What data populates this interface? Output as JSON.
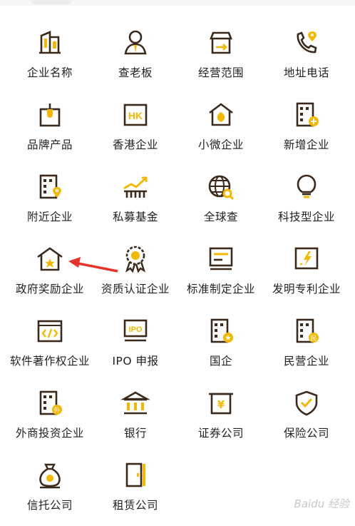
{
  "items": [
    {
      "label": "企业名称",
      "icon": "building-icon"
    },
    {
      "label": "查老板",
      "icon": "person-icon"
    },
    {
      "label": "经营范围",
      "icon": "shop-icon"
    },
    {
      "label": "地址电话",
      "icon": "phone-location-icon"
    },
    {
      "label": "品牌产品",
      "icon": "brand-product-icon"
    },
    {
      "label": "香港企业",
      "icon": "hk-badge-icon"
    },
    {
      "label": "小微企业",
      "icon": "house-leaf-icon"
    },
    {
      "label": "新增企业",
      "icon": "building-plus-icon"
    },
    {
      "label": "附近企业",
      "icon": "building-pin-icon"
    },
    {
      "label": "私募基金",
      "icon": "rising-chart-icon"
    },
    {
      "label": "全球查",
      "icon": "globe-search-icon"
    },
    {
      "label": "科技型企业",
      "icon": "lightbulb-icon"
    },
    {
      "label": "政府奖励企业",
      "icon": "house-star-icon"
    },
    {
      "label": "资质认证企业",
      "icon": "award-rosette-icon"
    },
    {
      "label": "标准制定企业",
      "icon": "document-lines-icon"
    },
    {
      "label": "发明专利企业",
      "icon": "patent-icon"
    },
    {
      "label": "软件著作权企业",
      "icon": "code-window-icon"
    },
    {
      "label": "IPO 申报",
      "icon": "ipo-icon"
    },
    {
      "label": "国企",
      "icon": "building-star-icon"
    },
    {
      "label": "民营企业",
      "icon": "building-private-icon"
    },
    {
      "label": "外商投资企业",
      "icon": "building-foreign-icon"
    },
    {
      "label": "银行",
      "icon": "bank-icon"
    },
    {
      "label": "证券公司",
      "icon": "yen-board-icon"
    },
    {
      "label": "保险公司",
      "icon": "shield-check-icon"
    },
    {
      "label": "信托公司",
      "icon": "money-bag-icon"
    },
    {
      "label": "租赁公司",
      "icon": "door-icon"
    }
  ],
  "colors": {
    "outline": "#3b2a1c",
    "accent": "#f5b800",
    "arrow": "#e8322a",
    "text": "#222222"
  },
  "badge_text": {
    "hk": "HK",
    "ipo": "IPO",
    "yen": "¥",
    "private": "民",
    "foreign": "外"
  },
  "watermark": "Baidu 经验"
}
